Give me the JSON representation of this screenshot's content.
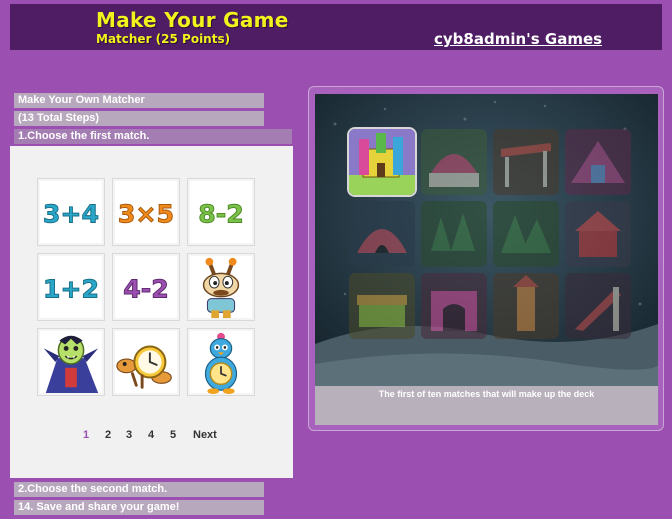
{
  "header": {
    "title": "Make Your Game",
    "subtitle": "Matcher (25 Points)",
    "owner_link": "cyb8admin's Games"
  },
  "steps": {
    "heading": "Make Your Own Matcher",
    "total": "(13 Total Steps)",
    "step1": "1.Choose the first match.",
    "step2": "2.Choose the second match.",
    "step14": "14. Save and share your game!"
  },
  "tiles": [
    {
      "id": "tile-3-plus-4",
      "text": "3+4",
      "color": "#2aa6c9"
    },
    {
      "id": "tile-3-times-5",
      "text": "3×5",
      "color": "#f08a1c"
    },
    {
      "id": "tile-8-minus-2",
      "text": "8-2",
      "color": "#7cc24a"
    },
    {
      "id": "tile-1-plus-2",
      "text": "1+2",
      "color": "#2aa6c9"
    },
    {
      "id": "tile-4-minus-2",
      "text": "4-2",
      "color": "#9b4fb0"
    },
    {
      "id": "tile-cartoon-dog",
      "icon": "cartoon-dog-icon"
    },
    {
      "id": "tile-vampire",
      "icon": "vampire-character-icon"
    },
    {
      "id": "tile-clock-dog",
      "icon": "clock-dog-icon"
    },
    {
      "id": "tile-penguin-clock",
      "icon": "penguin-clock-icon"
    }
  ],
  "pager": {
    "pages": [
      "1",
      "2",
      "3",
      "4",
      "5"
    ],
    "active": "1",
    "next": "Next"
  },
  "preview": {
    "caption": "The first of ten matches that will make up the deck"
  },
  "colors": {
    "background": "#9b4fb0",
    "header_bar": "#4e1d63",
    "title": "#f2f21c"
  }
}
